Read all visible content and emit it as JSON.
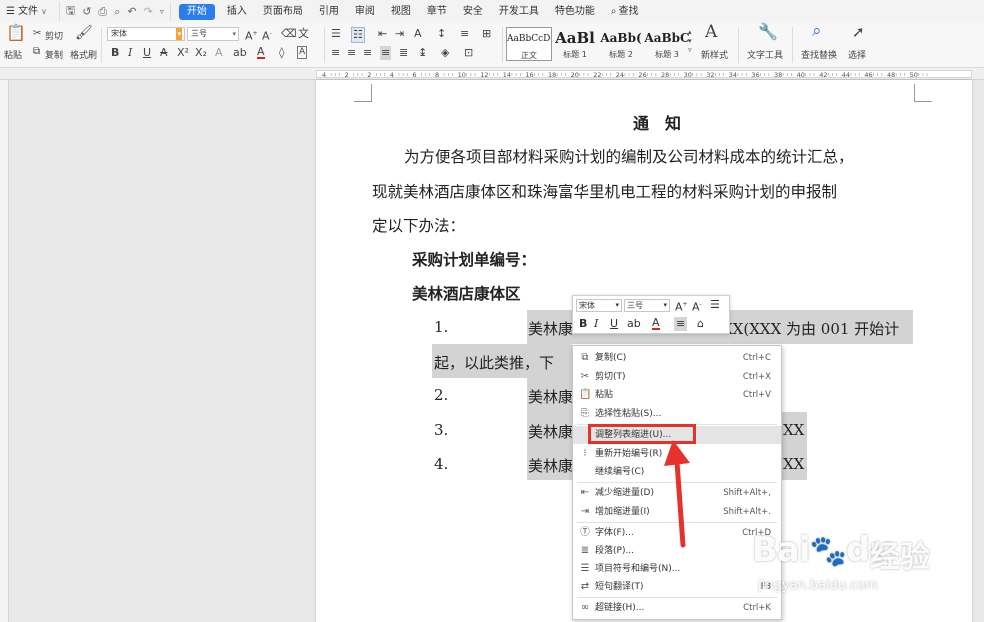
{
  "menubar": {
    "file": "文件",
    "tabs": [
      "开始",
      "插入",
      "页面布局",
      "引用",
      "审阅",
      "视图",
      "章节",
      "安全",
      "开发工具",
      "特色功能"
    ],
    "active_tab": "开始",
    "search": "查找"
  },
  "ribbon": {
    "paste": "粘贴",
    "cut": "剪切",
    "copy": "复制",
    "format_painter": "格式刷",
    "font_name": "宋体",
    "font_size": "三号",
    "styles": [
      {
        "preview": "AaBbCcDd",
        "name": "正文"
      },
      {
        "preview": "AaBl",
        "name": "标题 1"
      },
      {
        "preview": "AaBb(",
        "name": "标题 2"
      },
      {
        "preview": "AaBbC",
        "name": "标题 3"
      }
    ],
    "new_style": "新样式",
    "text_tool": "文字工具",
    "find_replace": "查找替换",
    "select": "选择"
  },
  "ruler": {
    "labels": [
      "4",
      "2",
      "2",
      "4",
      "6",
      "8",
      "10",
      "12",
      "14",
      "16",
      "18",
      "20",
      "22",
      "24",
      "26",
      "28",
      "30",
      "32",
      "34",
      "36",
      "38",
      "40",
      "42",
      "44",
      "46",
      "48",
      "50"
    ]
  },
  "document": {
    "title": "通　知",
    "para1": "为方便各项目部材料采购计划的编制及公司材料成本的统计汇总，",
    "para2": "现就美林酒店康体区和珠海富华里机电工程的材料采购计划的申报制",
    "para3": "定以下办法：",
    "heading1": "采购计划单编号：",
    "heading2": "美林酒店康体区",
    "list": [
      {
        "num": "1.",
        "text_a": "美林康",
        "text_b": "XX(XXX 为由 001 开始计"
      },
      {
        "num": "",
        "text_a": "起，以此类推，下",
        "text_b": ""
      },
      {
        "num": "2.",
        "text_a": "美林康",
        "text_b": ""
      },
      {
        "num": "3.",
        "text_a": "美林康",
        "text_b": "XX"
      },
      {
        "num": "4.",
        "text_a": "美林康",
        "text_b": "XX"
      }
    ]
  },
  "minibar": {
    "font": "宋体",
    "size": "三号"
  },
  "context_menu": {
    "items": [
      {
        "icon": "copy-icon",
        "label": "复制(C)",
        "shortcut": "Ctrl+C"
      },
      {
        "icon": "cut-icon",
        "label": "剪切(T)",
        "shortcut": "Ctrl+X"
      },
      {
        "icon": "paste-icon",
        "label": "粘贴",
        "shortcut": "Ctrl+V"
      },
      {
        "icon": "paste-special-icon",
        "label": "选择性粘贴(S)...",
        "shortcut": ""
      },
      {
        "icon": "",
        "label": "调整列表缩进(U)...",
        "shortcut": ""
      },
      {
        "icon": "restart-numbering-icon",
        "label": "重新开始编号(R)",
        "shortcut": ""
      },
      {
        "icon": "",
        "label": "继续编号(C)",
        "shortcut": ""
      },
      {
        "icon": "decrease-indent-icon",
        "label": "减少缩进量(D)",
        "shortcut": "Shift+Alt+,"
      },
      {
        "icon": "increase-indent-icon",
        "label": "增加缩进量(I)",
        "shortcut": "Shift+Alt+."
      },
      {
        "icon": "font-icon",
        "label": "字体(F)...",
        "shortcut": "Ctrl+D"
      },
      {
        "icon": "paragraph-icon",
        "label": "段落(P)...",
        "shortcut": ""
      },
      {
        "icon": "bullets-numbering-icon",
        "label": "项目符号和编号(N)...",
        "shortcut": ""
      },
      {
        "icon": "translate-icon",
        "label": "短句翻译(T)",
        "shortcut": "F8"
      },
      {
        "icon": "hyperlink-icon",
        "label": "超链接(H)...",
        "shortcut": "Ctrl+K"
      }
    ]
  },
  "watermark": {
    "brand": "Bai",
    "brand2": "du",
    "cn": "经验",
    "url": "jingyan.baidu.com"
  },
  "colors": {
    "accent": "#2b7de9",
    "highlight_box": "#e6322d",
    "selection": "#d3d3d3"
  }
}
